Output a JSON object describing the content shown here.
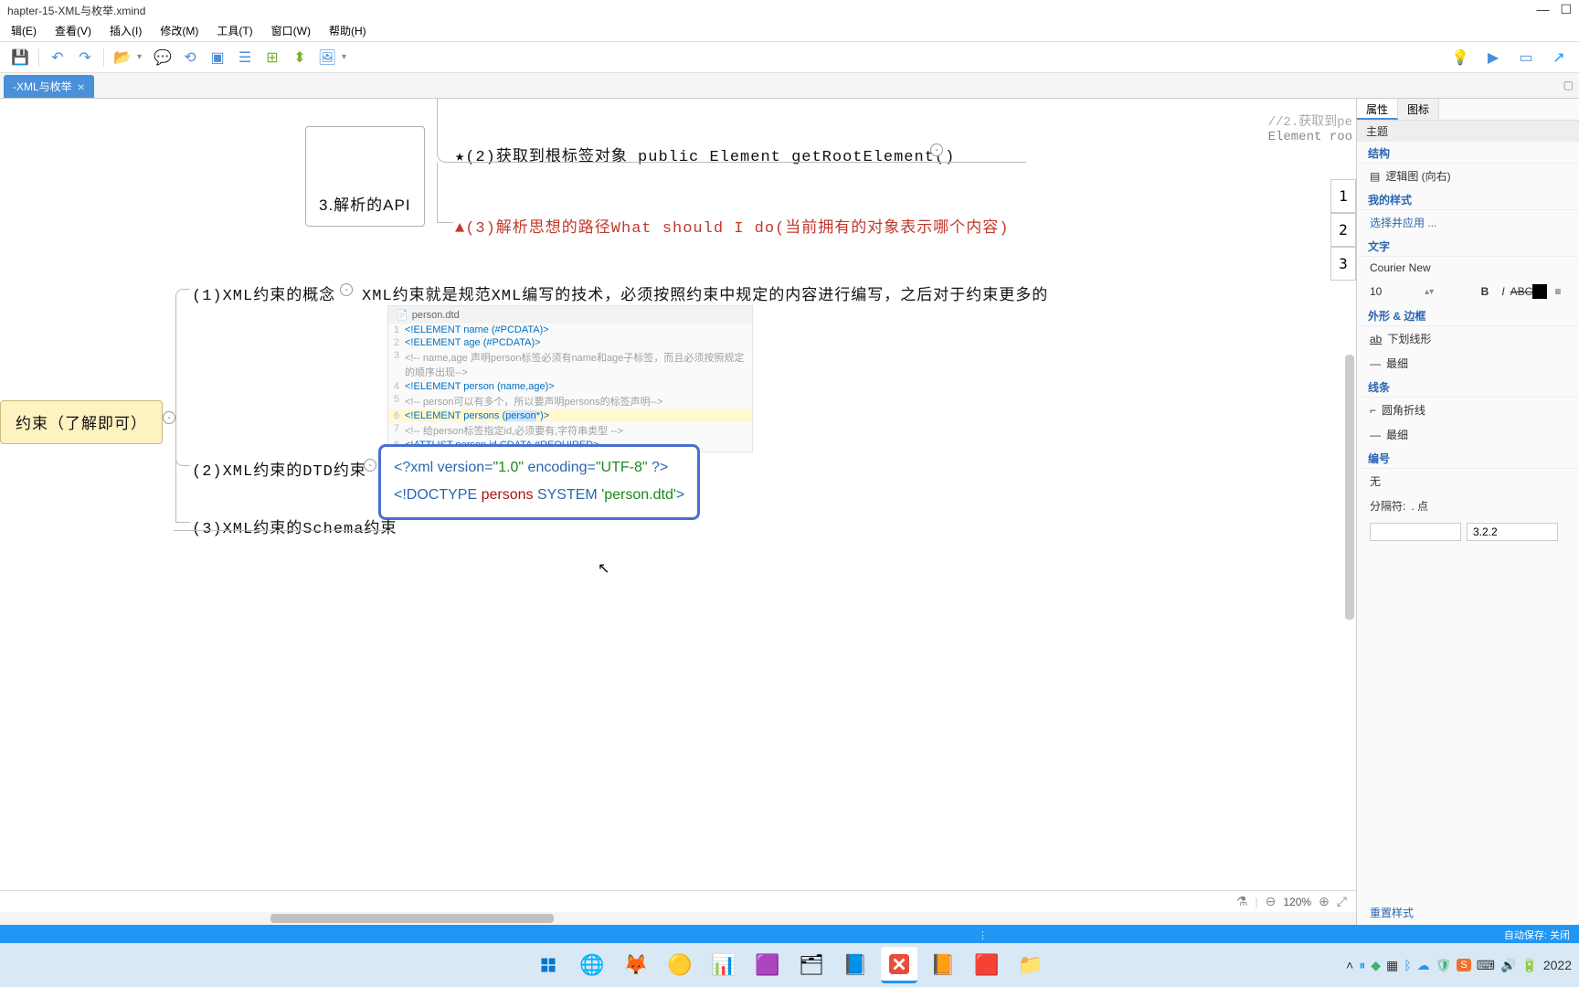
{
  "title": "hapter-15-XML与枚举.xmind",
  "menu": [
    "辑(E)",
    "查看(V)",
    "插入(I)",
    "修改(M)",
    "工具(T)",
    "窗口(W)",
    "帮助(H)"
  ],
  "tab": {
    "label": "-XML与枚举",
    "close": "×"
  },
  "canvas": {
    "api_node": "3.解析的API",
    "root_elem": "★(2)获取到根标签对象 public Element getRootElement()",
    "code_comment1": "//2.获取到pe",
    "code_comment2": "Element roo",
    "red_node": "▲(3)解析思想的路径What should I do(当前拥有的对象表示哪个内容)",
    "concept_label": "(1)XML约束的概念",
    "concept_text": "XML约束就是规范XML编写的技术，必须按照约束中规定的内容进行编写，之后对于约束更多的",
    "dtd_label": "(2)XML约束的DTD约束",
    "schema_label": "(3)XML约束的Schema约束",
    "yellow_node": "约束（了解即可）",
    "side_index": [
      "1",
      "2",
      "3"
    ],
    "dtd_file": "person.dtd",
    "dtd_lines": [
      "<!ELEMENT name (#PCDATA)>",
      "<!ELEMENT age (#PCDATA)>",
      "<!-- name,age 声明person标签必须有name和age子标签，而且必须按照规定的顺序出现-->",
      "<!ELEMENT person (name,age)>",
      "<!-- person可以有多个，所以要声明persons的标签声明-->",
      "<!ELEMENT persons (person*)>",
      "<!-- 给person标签指定id,必须要有,字符串类型 -->",
      "<!ATTLIST person id CDATA #REQUIRED>"
    ],
    "xml_line1_pre": "<?xml version=",
    "xml_line1_v": "\"1.0\"",
    "xml_line1_mid": " encoding=",
    "xml_line1_enc": "\"UTF-8\"",
    "xml_line1_post": " ?>",
    "xml_line2_pre": "<!DOCTYPE ",
    "xml_line2_p": "persons",
    "xml_line2_sys": " SYSTEM ",
    "xml_line2_file": "'person.dtd'",
    "xml_line2_post": ">"
  },
  "canvas_status": {
    "zoom": "120%"
  },
  "props": {
    "tabs": [
      "属性",
      "图标"
    ],
    "header": "主题",
    "structure": "结构",
    "structure_val": "逻辑图 (向右)",
    "my_style": "我的样式",
    "my_style_val": "选择并应用 ...",
    "text": "文字",
    "font": "Courier New",
    "size": "10",
    "shape": "外形 & 边框",
    "shape_val": "下划线形",
    "shape_thin": "最细",
    "line": "线条",
    "line_val": "圆角折线",
    "line_thin": "最细",
    "number": "编号",
    "number_val": "无",
    "sep_label": "分隔符:",
    "sep_val": ". 点",
    "sep_input": "3.2.2",
    "reset": "重置样式"
  },
  "bluebar": {
    "autosave": "自动保存: 关闭"
  },
  "taskbar": {
    "time": "2022"
  }
}
